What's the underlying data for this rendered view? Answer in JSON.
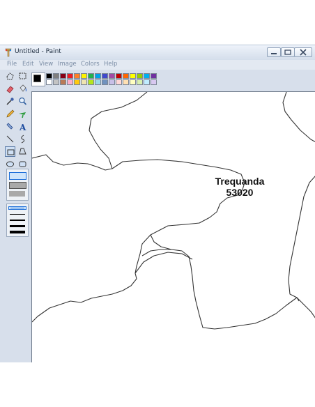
{
  "window": {
    "title": "Untitled - Paint"
  },
  "menu": [
    {
      "label": "File"
    },
    {
      "label": "Edit"
    },
    {
      "label": "View"
    },
    {
      "label": "Image"
    },
    {
      "label": "Colors"
    },
    {
      "label": "Help"
    }
  ],
  "palette": {
    "foreground": "#000000",
    "background": "#ffffff",
    "row1": [
      "#000000",
      "#7f7f7f",
      "#880015",
      "#ed1c24",
      "#ff7f27",
      "#fff200",
      "#22b14c",
      "#00a2e8",
      "#3f48cc",
      "#a349a4",
      "#c00000",
      "#ff6600",
      "#ffff00",
      "#99cc00",
      "#00b0f0",
      "#7030a0"
    ],
    "row2": [
      "#ffffff",
      "#c3c3c3",
      "#b97a57",
      "#ffaec9",
      "#ffc90e",
      "#efe4b0",
      "#b5e61d",
      "#99d9ea",
      "#7092be",
      "#c8bfe7",
      "#ffd7d7",
      "#ffe0b2",
      "#ffffc0",
      "#d8f0b0",
      "#c0ecff",
      "#d8c8f0"
    ]
  },
  "tools": [
    {
      "name": "free-select",
      "icon": "star-select-icon"
    },
    {
      "name": "select",
      "icon": "rect-select-icon"
    },
    {
      "name": "eraser",
      "icon": "eraser-icon"
    },
    {
      "name": "fill",
      "icon": "bucket-icon"
    },
    {
      "name": "color-picker",
      "icon": "eyedropper-icon"
    },
    {
      "name": "magnifier",
      "icon": "magnifier-icon"
    },
    {
      "name": "pencil",
      "icon": "pencil-icon"
    },
    {
      "name": "brush",
      "icon": "brush-icon"
    },
    {
      "name": "airbrush",
      "icon": "airbrush-icon"
    },
    {
      "name": "text",
      "icon": "text-a-icon"
    },
    {
      "name": "line",
      "icon": "line-icon"
    },
    {
      "name": "curve",
      "icon": "curve-icon"
    },
    {
      "name": "rectangle",
      "icon": "rectangle-icon"
    },
    {
      "name": "polygon",
      "icon": "polygon-icon"
    },
    {
      "name": "ellipse",
      "icon": "ellipse-icon"
    },
    {
      "name": "rounded-rectangle",
      "icon": "rounded-rect-icon"
    }
  ],
  "canvas": {
    "label_line1": "Trequanda",
    "label_line2": "53020"
  }
}
